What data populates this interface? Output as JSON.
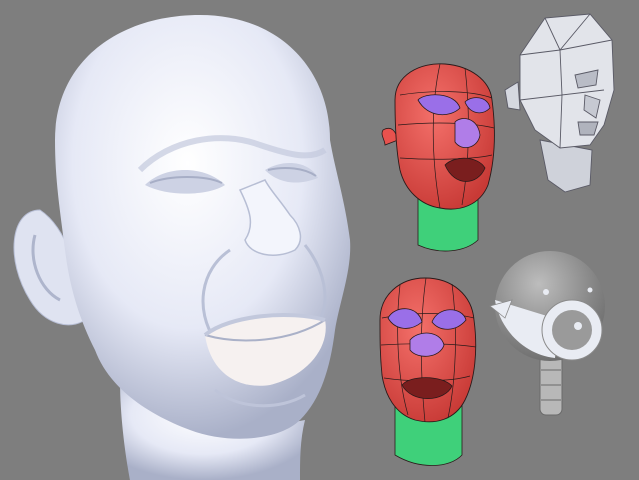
{
  "scene": {
    "background": "#7e7e7e",
    "colors": {
      "clay": "#eef1fb",
      "clay_shade": "#b9c0d6",
      "face_red": "#e8524e",
      "eye_purple": "#9a6fe8",
      "neck_green": "#3fd07a",
      "wire": "#2a1a1a",
      "lowpoly": "#e2e4ea",
      "lowpoly_edge": "#5a5a66",
      "sphere_gray": "#8d8d8d",
      "sphere_white": "#e9ecf3"
    },
    "icons": [
      "sculpted-head-icon",
      "topology-head-icon",
      "lowpoly-head-icon",
      "primitive-head-icon"
    ]
  }
}
